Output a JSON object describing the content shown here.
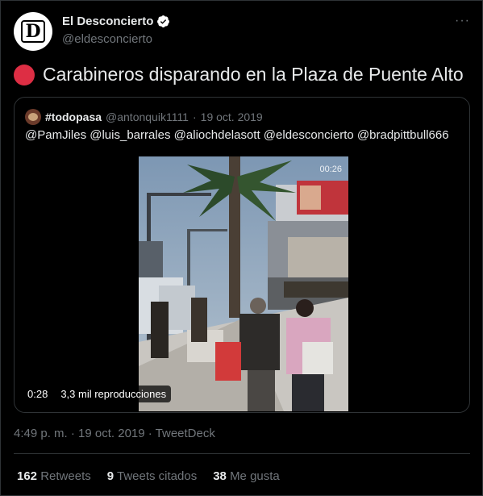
{
  "author": {
    "display_name": "El Desconcierto",
    "handle": "@eldesconcierto",
    "avatar_letter": "D",
    "verified": true,
    "more_label": "···"
  },
  "tweet": {
    "emoji_icon": "red-circle",
    "text": "Carabineros disparando en la Plaza de Puente Alto"
  },
  "quoted": {
    "display_name": "#todopasa",
    "handle": "@antonquik1111",
    "separator": "·",
    "date": "19 oct. 2019",
    "text": "@PamJiles @luis_barrales @aliochdelasott @eldesconcierto @bradpittbull666",
    "video": {
      "remaining_time": "00:26",
      "duration": "0:28",
      "views": "3,3 mil reproducciones"
    }
  },
  "meta": {
    "timestamp": "4:49 p. m. · 19 oct. 2019 · TweetDeck"
  },
  "stats": {
    "retweets_count": "162",
    "retweets_label": "Retweets",
    "quotes_count": "9",
    "quotes_label": "Tweets citados",
    "likes_count": "38",
    "likes_label": "Me gusta"
  },
  "colors": {
    "background": "#000000",
    "text_primary": "#e7e9ea",
    "text_secondary": "#71767b",
    "border": "#2f3336",
    "verified_badge": "#ffffff",
    "emoji_red": "#dd2e44"
  }
}
